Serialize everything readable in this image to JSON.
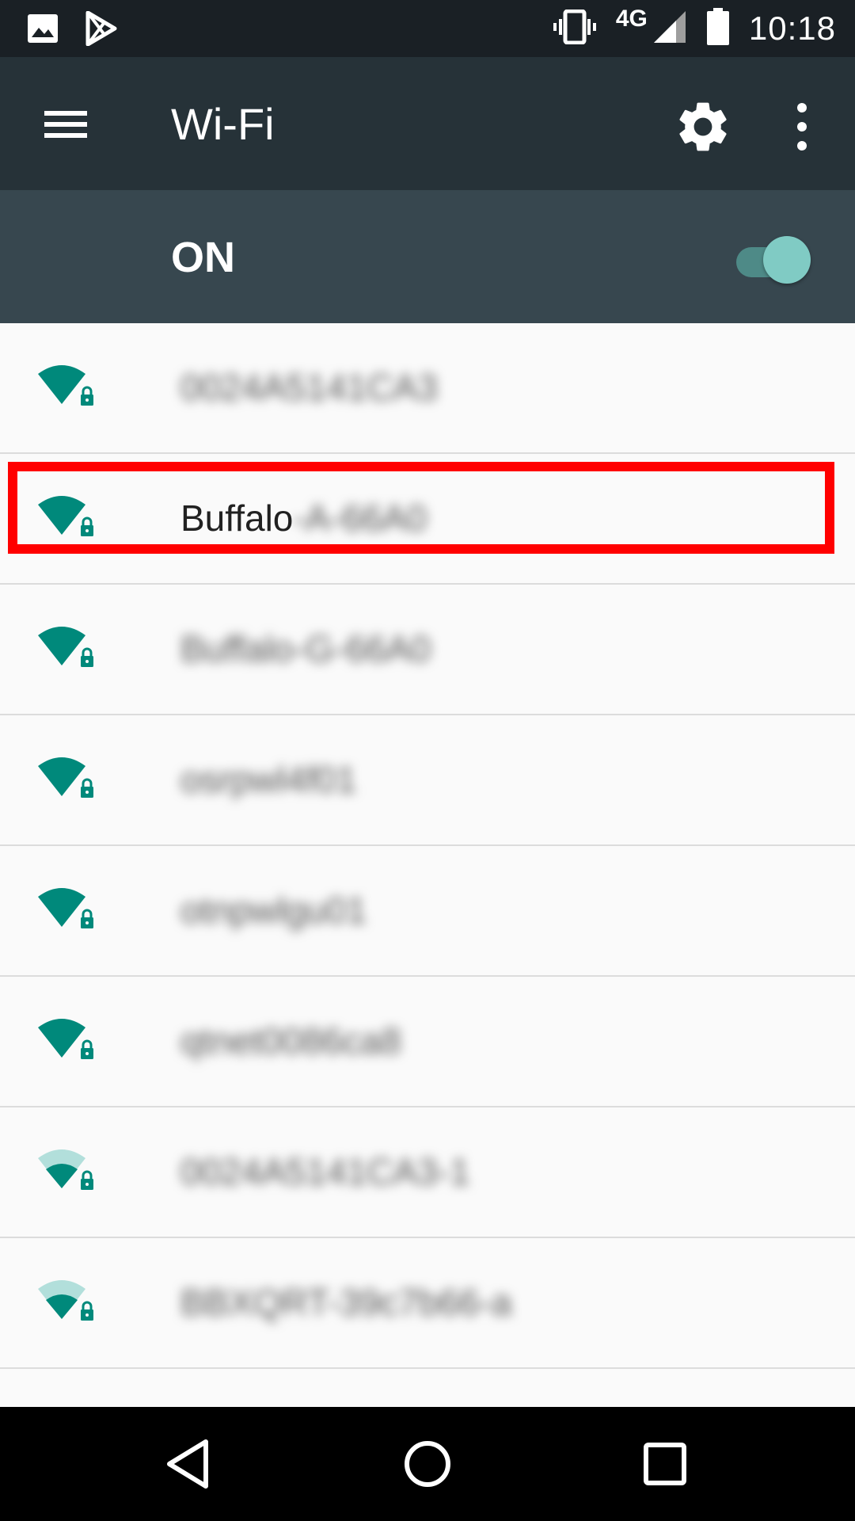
{
  "status_bar": {
    "time": "10:18",
    "network": "4G",
    "icons": [
      "image-icon",
      "play-store-icon",
      "vibrate-icon",
      "signal-icon",
      "battery-icon"
    ]
  },
  "app_bar": {
    "title": "Wi-Fi",
    "icons": [
      "menu-icon",
      "gear-icon",
      "more-vert-icon"
    ]
  },
  "wifi_switch": {
    "label": "ON",
    "enabled": true
  },
  "networks": [
    {
      "ssid_visible": "",
      "ssid_obscured": "0024A5141CA3",
      "signal": "full",
      "secured": true
    },
    {
      "ssid_visible": "Buffalo",
      "ssid_obscured": "-A-66A0",
      "signal": "full",
      "secured": true,
      "highlighted": true
    },
    {
      "ssid_visible": "",
      "ssid_obscured": "Buffalo-G-66A0",
      "signal": "full",
      "secured": true
    },
    {
      "ssid_visible": "",
      "ssid_obscured": "osrpwl4f01",
      "signal": "full",
      "secured": true
    },
    {
      "ssid_visible": "",
      "ssid_obscured": "otnpwlgu01",
      "signal": "full",
      "secured": true
    },
    {
      "ssid_visible": "",
      "ssid_obscured": "qtnet0086ca8",
      "signal": "full",
      "secured": true
    },
    {
      "ssid_visible": "",
      "ssid_obscured": "0024A5141CA3-1",
      "signal": "medium",
      "secured": true
    },
    {
      "ssid_visible": "",
      "ssid_obscured": "BBXQRT-39c7b66-a",
      "signal": "medium",
      "secured": true
    }
  ],
  "colors": {
    "accent": "#00897b",
    "accent_light": "#b2dfdb",
    "status_bar": "#1a2025",
    "app_bar": "#263238",
    "switch_bar": "#37474f",
    "highlight": "#ff0000"
  },
  "nav_bar": {
    "icons": [
      "back-icon",
      "home-icon",
      "recents-icon"
    ]
  }
}
